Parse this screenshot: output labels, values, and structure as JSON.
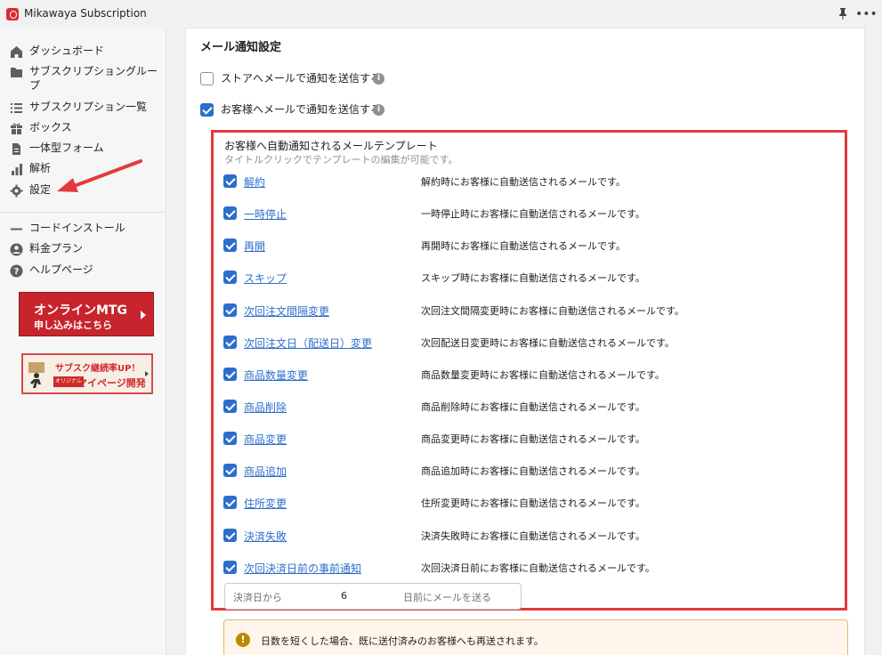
{
  "titlebar": {
    "app_title": "Mikawaya Subscription",
    "icons": [
      "app-logo",
      "pin-icon",
      "more-icon"
    ]
  },
  "sidebar": {
    "items": [
      {
        "label": "ダッシュボード",
        "icon": "home-icon"
      },
      {
        "label": "サブスクリプショングループ",
        "icon": "folder-icon"
      },
      {
        "label": "サブスクリプション一覧",
        "icon": "list-icon"
      },
      {
        "label": "ボックス",
        "icon": "gift-icon"
      },
      {
        "label": "一体型フォーム",
        "icon": "document-icon"
      },
      {
        "label": "解析",
        "icon": "bar-chart-icon"
      },
      {
        "label": "設定",
        "icon": "gear-icon"
      }
    ],
    "secondary_items": [
      {
        "label": "コードインストール",
        "icon": "code-icon"
      },
      {
        "label": "料金プラン",
        "icon": "user-circle-icon"
      },
      {
        "label": "ヘルプページ",
        "icon": "help-icon"
      }
    ],
    "banner_mtg": {
      "line1": "オンラインMTG",
      "line2": "申し込みはこちら"
    },
    "banner_mypage": {
      "line1": "サブスク継続率UP！",
      "tag": "オリジナル",
      "line2": "マイページ開発"
    }
  },
  "main": {
    "section_title": "メール通知設定",
    "store_option": {
      "label": "ストアへメールで通知を送信する",
      "checked": false
    },
    "customer_option": {
      "label": "お客様へメールで通知を送信する",
      "checked": true
    },
    "templates": {
      "title": "お客様へ自動通知されるメールテンプレート",
      "subtitle": "タイトルクリックでテンプレートの編集が可能です。",
      "rows": [
        {
          "name": "解約",
          "desc": "解約時にお客様に自動送信されるメールです。",
          "checked": true
        },
        {
          "name": "一時停止",
          "desc": "一時停止時にお客様に自動送信されるメールです。",
          "checked": true
        },
        {
          "name": "再開",
          "desc": "再開時にお客様に自動送信されるメールです。",
          "checked": true
        },
        {
          "name": "スキップ",
          "desc": "スキップ時にお客様に自動送信されるメールです。",
          "checked": true
        },
        {
          "name": "次回注文間隔変更",
          "desc": "次回注文間隔変更時にお客様に自動送信されるメールです。",
          "checked": true
        },
        {
          "name": "次回注文日（配送日）変更",
          "desc": "次回配送日変更時にお客様に自動送信されるメールです。",
          "checked": true
        },
        {
          "name": "商品数量変更",
          "desc": "商品数量変更時にお客様に自動送信されるメールです。",
          "checked": true
        },
        {
          "name": "商品削除",
          "desc": "商品削除時にお客様に自動送信されるメールです。",
          "checked": true
        },
        {
          "name": "商品変更",
          "desc": "商品変更時にお客様に自動送信されるメールです。",
          "checked": true
        },
        {
          "name": "商品追加",
          "desc": "商品追加時にお客様に自動送信されるメールです。",
          "checked": true
        },
        {
          "name": "住所変更",
          "desc": "住所変更時にお客様に自動送信されるメールです。",
          "checked": true
        },
        {
          "name": "決済失敗",
          "desc": "決済失敗時にお客様に自動送信されるメールです。",
          "checked": true
        },
        {
          "name": "次回決済日前の事前通知",
          "desc": "次回決済日前にお客様に自動送信されるメールです。",
          "checked": true
        }
      ],
      "days_field": {
        "prefix": "決済日から",
        "value": "6",
        "suffix": "日前にメールを送る"
      }
    },
    "warning": {
      "text": "日数を短くした場合、既に送付済みのお客様へも再送されます。"
    }
  },
  "colors": {
    "accent": "#2c6ecb",
    "highlight_border": "#e23b3b",
    "brand_red": "#c8242d",
    "warning_bg": "#fff5ea"
  }
}
